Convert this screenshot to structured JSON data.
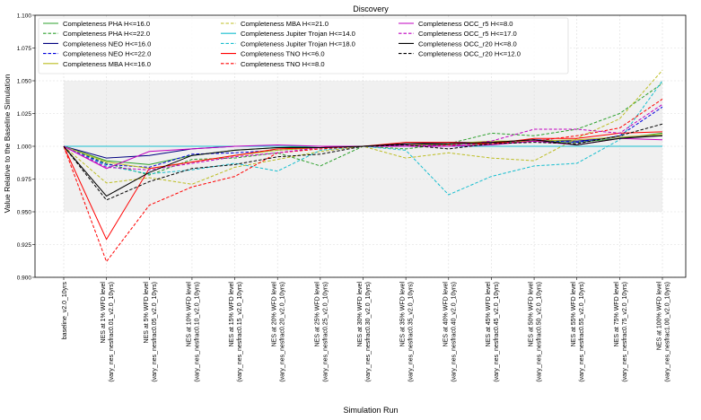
{
  "chart_data": {
    "type": "line",
    "title": "Discovery",
    "xlabel": "Simulation Run",
    "ylabel": "Value Relative to the Baseline Simulation",
    "ylim": [
      0.9,
      1.1
    ],
    "yticks": [
      "0.900",
      "0.925",
      "0.950",
      "0.975",
      "1.000",
      "1.025",
      "1.050",
      "1.075",
      "1.100"
    ],
    "grid": true,
    "legend_position": "top-left",
    "shaded_band": [
      0.95,
      1.05
    ],
    "categories": [
      [
        "baseline_v2.0_10yrs"
      ],
      [
        "NES at 1% WFD level",
        "(vary_nes_nesfrac0.01_v2.0_10yrs)"
      ],
      [
        "NES at 5% WFD level",
        "(vary_nes_nesfrac0.05_v2.0_10yrs)"
      ],
      [
        "NES at 10% WFD level",
        "(vary_nes_nesfrac0.10_v2.0_10yrs)"
      ],
      [
        "NES at 15% WFD level",
        "(vary_nes_nesfrac0.15_v2.0_10yrs)"
      ],
      [
        "NES at 20% WFD level",
        "(vary_nes_nesfrac0.20_v2.0_10yrs)"
      ],
      [
        "NES at 25% WFD level",
        "(vary_nes_nesfrac0.25_v2.0_10yrs)"
      ],
      [
        "NES at 30% WFD level",
        "(vary_nes_nesfrac0.30_v2.0_10yrs)"
      ],
      [
        "NES at 35% WFD level",
        "(vary_nes_nesfrac0.35_v2.0_10yrs)"
      ],
      [
        "NES at 40% WFD level",
        "(vary_nes_nesfrac0.40_v2.0_10yrs)"
      ],
      [
        "NES at 45% WFD level",
        "(vary_nes_nesfrac0.45_v2.0_10yrs)"
      ],
      [
        "NES at 50% WFD level",
        "(vary_nes_nesfrac0.50_v2.0_10yrs)"
      ],
      [
        "NES at 55% WFD level",
        "(vary_nes_nesfrac0.55_v2.0_10yrs)"
      ],
      [
        "NES at 75% WFD level",
        "(vary_nes_nesfrac0.75_v2.0_10yrs)"
      ],
      [
        "NES at 100% WFD level",
        "(vary_nes_nesfrac1.00_v2.0_10yrs)"
      ]
    ],
    "series": [
      {
        "name": "Completeness PHA H<=16.0",
        "color": "#2ca02c",
        "dash": "solid",
        "values": [
          1.0,
          0.989,
          0.986,
          0.993,
          0.997,
          0.999,
          1.0,
          1.0,
          1.001,
          1.001,
          1.002,
          1.004,
          1.003,
          1.006,
          1.01
        ]
      },
      {
        "name": "Completeness PHA H<=22.0",
        "color": "#2ca02c",
        "dash": "dashed",
        "values": [
          1.0,
          0.987,
          0.978,
          0.99,
          0.991,
          0.995,
          0.985,
          1.0,
          0.998,
          1.002,
          1.01,
          1.008,
          1.013,
          1.025,
          1.048
        ]
      },
      {
        "name": "Completeness NEO H<=16.0",
        "color": "#000080",
        "dash": "solid",
        "values": [
          1.0,
          0.991,
          0.993,
          0.998,
          1.0,
          1.0,
          1.0,
          1.0,
          1.002,
          1.003,
          1.003,
          1.005,
          1.004,
          1.007,
          1.008
        ]
      },
      {
        "name": "Completeness NEO H<=22.0",
        "color": "#0000dd",
        "dash": "dashed",
        "values": [
          1.0,
          0.986,
          0.984,
          0.994,
          0.995,
          0.997,
          0.999,
          1.0,
          1.001,
          1.001,
          1.002,
          1.005,
          1.003,
          1.008,
          1.03
        ]
      },
      {
        "name": "Completeness MBA H<=16.0",
        "color": "#bcbd22",
        "dash": "solid",
        "values": [
          1.0,
          0.988,
          0.983,
          0.988,
          0.993,
          0.997,
          0.999,
          1.0,
          1.001,
          1.002,
          1.004,
          1.004,
          1.005,
          1.007,
          1.009
        ]
      },
      {
        "name": "Completeness MBA H<=21.0",
        "color": "#bcbd22",
        "dash": "dashed",
        "values": [
          1.0,
          0.972,
          0.976,
          0.971,
          0.984,
          0.99,
          0.996,
          1.0,
          0.991,
          0.995,
          0.991,
          0.989,
          1.006,
          1.021,
          1.058
        ]
      },
      {
        "name": "Completeness Jupiter Trojan H<=14.0",
        "color": "#17becf",
        "dash": "solid",
        "values": [
          1.0,
          1.0,
          1.0,
          1.0,
          1.0,
          1.0,
          1.0,
          1.0,
          1.0,
          1.0,
          1.0,
          1.0,
          1.0,
          1.0,
          1.0
        ]
      },
      {
        "name": "Completeness Jupiter Trojan H<=18.0",
        "color": "#17becf",
        "dash": "dashed",
        "values": [
          1.0,
          0.985,
          0.979,
          0.982,
          0.987,
          0.981,
          0.997,
          1.0,
          0.997,
          0.963,
          0.977,
          0.985,
          0.987,
          1.005,
          1.05
        ]
      },
      {
        "name": "Completeness TNO H<=6.0",
        "color": "#ff0000",
        "dash": "solid",
        "values": [
          1.0,
          0.929,
          0.983,
          0.988,
          0.993,
          0.998,
          0.999,
          1.0,
          1.003,
          1.003,
          1.002,
          1.006,
          1.006,
          1.01,
          1.011
        ]
      },
      {
        "name": "Completeness TNO H<=8.0",
        "color": "#ff0000",
        "dash": "dashed",
        "values": [
          1.0,
          0.912,
          0.955,
          0.969,
          0.977,
          0.995,
          0.998,
          1.0,
          1.0,
          1.001,
          1.002,
          1.004,
          1.008,
          1.014,
          1.036
        ]
      },
      {
        "name": "Completeness OCC_r5 H<=8.0",
        "color": "#c000c0",
        "dash": "solid",
        "values": [
          1.0,
          0.983,
          0.996,
          0.998,
          1.0,
          1.001,
          1.0,
          1.0,
          1.0,
          1.0,
          1.001,
          1.004,
          1.001,
          1.006,
          1.005
        ]
      },
      {
        "name": "Completeness OCC_r5 H<=17.0",
        "color": "#c000c0",
        "dash": "dashed",
        "values": [
          1.0,
          0.984,
          0.982,
          0.987,
          0.992,
          0.995,
          0.999,
          1.0,
          1.001,
          1.0,
          1.004,
          1.013,
          1.013,
          1.01,
          1.032
        ]
      },
      {
        "name": "Completeness OCC_r20 H<=8.0",
        "color": "#000000",
        "dash": "solid",
        "values": [
          1.0,
          0.962,
          0.98,
          0.993,
          0.997,
          0.999,
          0.999,
          1.0,
          1.002,
          1.002,
          1.003,
          1.005,
          1.001,
          1.006,
          1.008
        ]
      },
      {
        "name": "Completeness OCC_r20 H<=12.0",
        "color": "#000000",
        "dash": "dashed",
        "values": [
          1.0,
          0.959,
          0.973,
          0.983,
          0.986,
          0.992,
          0.994,
          1.0,
          1.001,
          0.998,
          1.002,
          1.003,
          1.002,
          1.008,
          1.017
        ]
      }
    ]
  }
}
